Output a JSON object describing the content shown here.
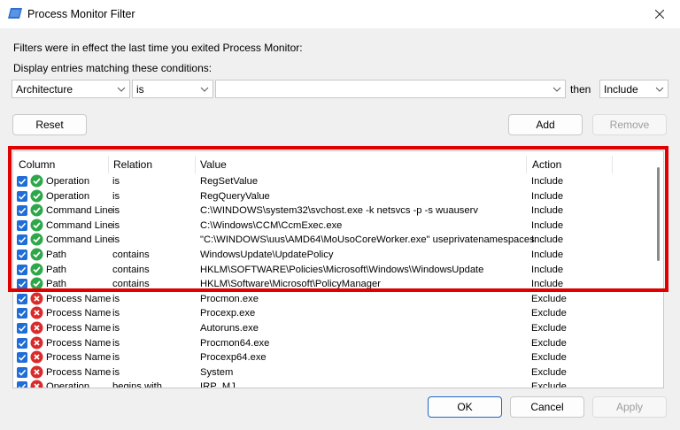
{
  "window": {
    "title": "Process Monitor Filter"
  },
  "texts": {
    "prior": "Filters were in effect the last time you exited Process Monitor:",
    "display": "Display entries matching these conditions:",
    "then": "then"
  },
  "condition": {
    "column": "Architecture",
    "relation": "is",
    "value": "",
    "action": "Include"
  },
  "buttons": {
    "reset": "Reset",
    "add": "Add",
    "remove": "Remove",
    "ok": "OK",
    "cancel": "Cancel",
    "apply": "Apply"
  },
  "list": {
    "headers": {
      "column": "Column",
      "relation": "Relation",
      "value": "Value",
      "action": "Action"
    },
    "rows": [
      {
        "column": "Operation",
        "relation": "is",
        "value": "RegSetValue",
        "action": "Include"
      },
      {
        "column": "Operation",
        "relation": "is",
        "value": "RegQueryValue",
        "action": "Include"
      },
      {
        "column": "Command Line",
        "relation": "is",
        "value": "C:\\WINDOWS\\system32\\svchost.exe -k netsvcs -p -s wuauserv",
        "action": "Include"
      },
      {
        "column": "Command Line",
        "relation": "is",
        "value": "C:\\Windows\\CCM\\CcmExec.exe",
        "action": "Include"
      },
      {
        "column": "Command Line",
        "relation": "is",
        "value": "\"C:\\WINDOWS\\uus\\AMD64\\MoUsoCoreWorker.exe\" useprivatenamespaces",
        "action": "Include"
      },
      {
        "column": "Path",
        "relation": "contains",
        "value": "WindowsUpdate\\UpdatePolicy",
        "action": "Include"
      },
      {
        "column": "Path",
        "relation": "contains",
        "value": "HKLM\\SOFTWARE\\Policies\\Microsoft\\Windows\\WindowsUpdate",
        "action": "Include"
      },
      {
        "column": "Path",
        "relation": "contains",
        "value": "HKLM\\Software\\Microsoft\\PolicyManager",
        "action": "Include"
      },
      {
        "column": "Process Name",
        "relation": "is",
        "value": "Procmon.exe",
        "action": "Exclude"
      },
      {
        "column": "Process Name",
        "relation": "is",
        "value": "Procexp.exe",
        "action": "Exclude"
      },
      {
        "column": "Process Name",
        "relation": "is",
        "value": "Autoruns.exe",
        "action": "Exclude"
      },
      {
        "column": "Process Name",
        "relation": "is",
        "value": "Procmon64.exe",
        "action": "Exclude"
      },
      {
        "column": "Process Name",
        "relation": "is",
        "value": "Procexp64.exe",
        "action": "Exclude"
      },
      {
        "column": "Process Name",
        "relation": "is",
        "value": "System",
        "action": "Exclude"
      },
      {
        "column": "Operation",
        "relation": "begins with",
        "value": "IRP_MJ_",
        "action": "Exclude"
      }
    ]
  },
  "icons": {
    "include": "green-check-icon",
    "exclude": "red-x-icon",
    "enabled": "checkbox-checked-icon"
  },
  "colors": {
    "include": "#2ea64a",
    "exclude": "#d92b2b",
    "checkbox": "#1f6dd6",
    "highlight": "#e00000",
    "ok_border": "#2066c4"
  }
}
